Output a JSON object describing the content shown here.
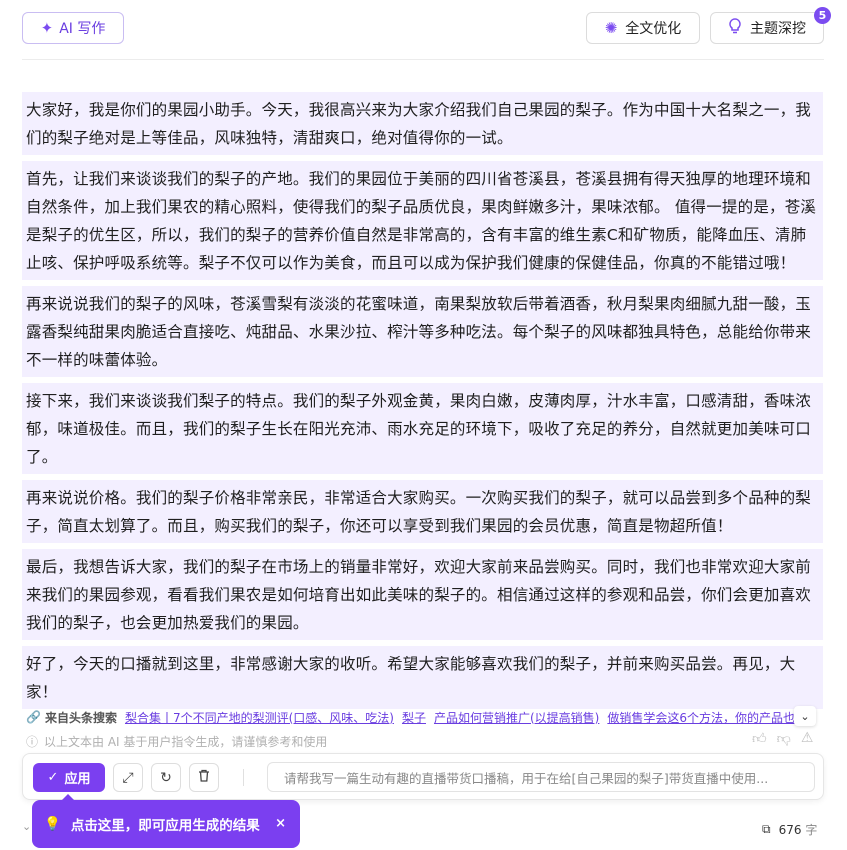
{
  "toolbar": {
    "ai_write_label": "AI 写作",
    "ai_write_icon": "sparkle-icon",
    "optimize_label": "全文优化",
    "optimize_icon": "loading-sparkle-icon",
    "theme_label": "主题深挖",
    "theme_icon": "lightbulb-icon",
    "theme_badge": "5"
  },
  "paragraphs": [
    "大家好，我是你们的果园小助手。今天，我很高兴来为大家介绍我们自己果园的梨子。作为中国十大名梨之一，我们的梨子绝对是上等佳品，风味独特，清甜爽口，绝对值得你的一试。",
    "首先，让我们来谈谈我们的梨子的产地。我们的果园位于美丽的四川省苍溪县，苍溪县拥有得天独厚的地理环境和自然条件，加上我们果农的精心照料，使得我们的梨子品质优良，果肉鲜嫩多汁，果味浓郁。 值得一提的是，苍溪是梨子的优生区，所以，我们的梨子的营养价值自然是非常高的，含有丰富的维生素C和矿物质，能降血压、清肺止咳、保护呼吸系统等。梨子不仅可以作为美食，而且可以成为保护我们健康的保健佳品，你真的不能错过哦！",
    "再来说说我们的梨子的风味，苍溪雪梨有淡淡的花蜜味道，南果梨放软后带着酒香，秋月梨果肉细腻九甜一酸，玉露香梨纯甜果肉脆适合直接吃、炖甜品、水果沙拉、榨汁等多种吃法。每个梨子的风味都独具特色，总能给你带来不一样的味蕾体验。",
    "接下来，我们来谈谈我们梨子的特点。我们的梨子外观金黄，果肉白嫩，皮薄肉厚，汁水丰富，口感清甜，香味浓郁，味道极佳。而且，我们的梨子生长在阳光充沛、雨水充足的环境下，吸收了充足的养分，自然就更加美味可口了。",
    "再来说说价格。我们的梨子价格非常亲民，非常适合大家购买。一次购买我们的梨子，就可以品尝到多个品种的梨子，简直太划算了。而且，购买我们的梨子，你还可以享受到我们果园的会员优惠，简直是物超所值！",
    "最后，我想告诉大家，我们的梨子在市场上的销量非常好，欢迎大家前来品尝购买。同时，我们也非常欢迎大家前来我们的果园参观，看看我们果农是如何培育出如此美味的梨子的。相信通过这样的参观和品尝，你们会更加喜欢我们的梨子，也会更加热爱我们的果园。",
    "好了，今天的口播就到这里，非常感谢大家的收听。希望大家能够喜欢我们的梨子，并前来购买品尝。再见，大家！"
  ],
  "source": {
    "label": "来自头条搜索",
    "links": [
      "梨合集丨7个不同产地的梨测评(口感、风味、吃法)",
      "梨子",
      "产品如何营销推广(以提高销售)",
      "做销售学会这6个方法，你的产品也"
    ]
  },
  "disclaimer": "以上文本由 AI 基于用户指令生成，请谨慎参考和使用",
  "actions": {
    "apply_label": "应用",
    "prompt_placeholder": "请帮我写一篇生动有趣的直播带货口播稿，用于在给[自己果园的梨子]带货直播中使用..."
  },
  "tooltip": {
    "text": "点击这里，即可应用生成的结果",
    "close": "×"
  },
  "word_count": {
    "value": "676",
    "unit": "字"
  }
}
